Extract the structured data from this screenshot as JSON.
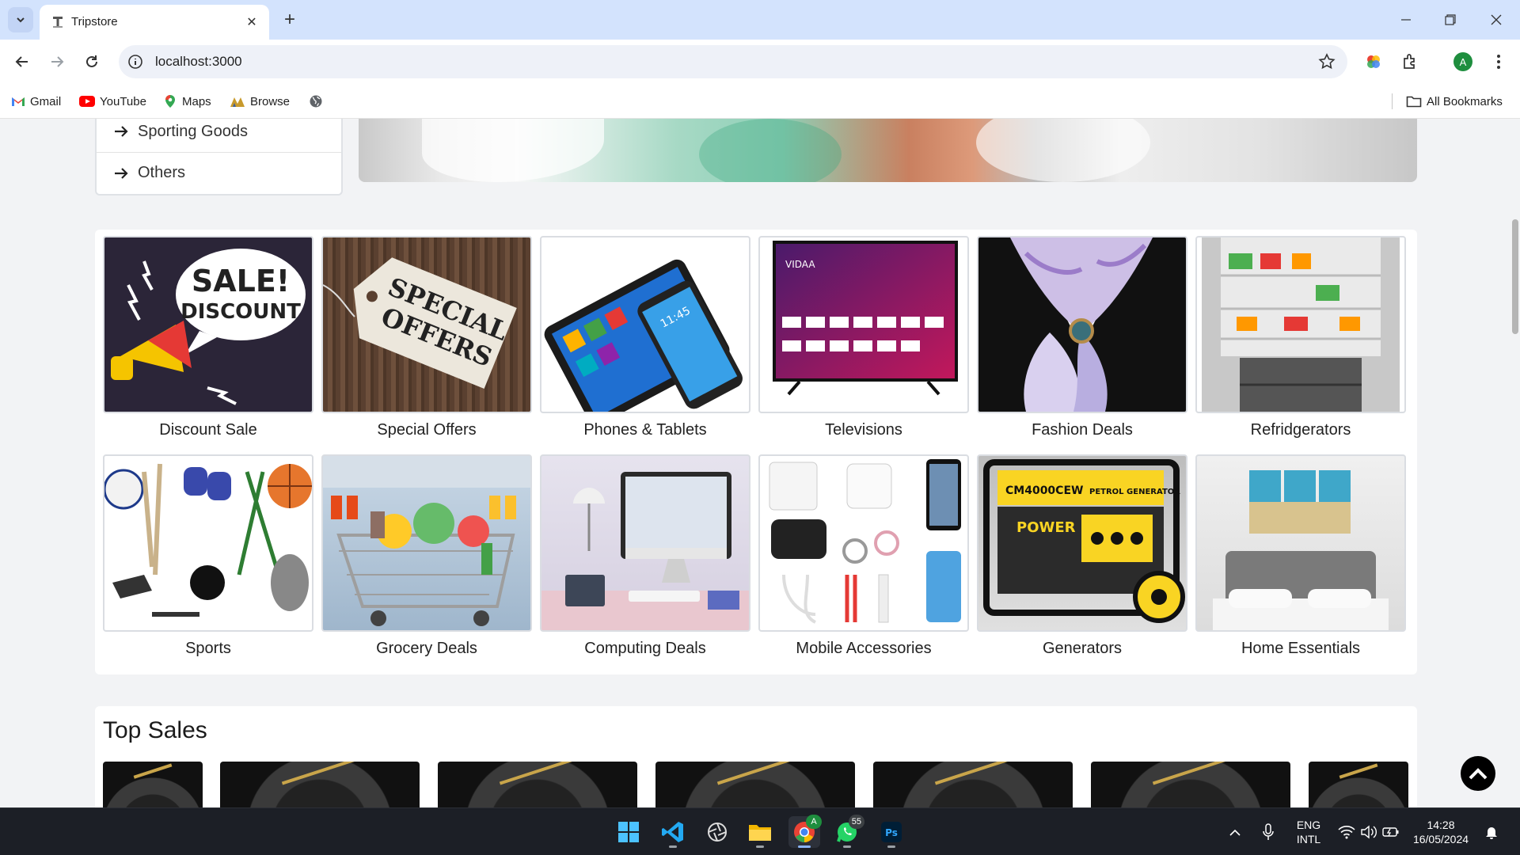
{
  "browser": {
    "tab_title": "Tripstore",
    "url": "localhost:3000",
    "profile_initial": "A",
    "bookmarks": [
      {
        "label": "Gmail",
        "icon": "gmail-icon"
      },
      {
        "label": "YouTube",
        "icon": "youtube-icon"
      },
      {
        "label": "Maps",
        "icon": "maps-icon"
      },
      {
        "label": "Browse",
        "icon": "browse-icon"
      }
    ],
    "all_bookmarks": "All Bookmarks"
  },
  "sidebar": {
    "items": [
      {
        "label": "Sporting Goods"
      },
      {
        "label": "Others"
      }
    ]
  },
  "categories": [
    {
      "label": "Discount Sale",
      "image": "sale-discount-megaphone"
    },
    {
      "label": "Special Offers",
      "image": "special-offers-tag"
    },
    {
      "label": "Phones & Tablets",
      "image": "phone-tablet"
    },
    {
      "label": "Televisions",
      "image": "smart-tv"
    },
    {
      "label": "Fashion Deals",
      "image": "silk-scarf"
    },
    {
      "label": "Refridgerators",
      "image": "open-fridge"
    },
    {
      "label": "Sports",
      "image": "sports-equipment"
    },
    {
      "label": "Grocery Deals",
      "image": "grocery-cart"
    },
    {
      "label": "Computing Deals",
      "image": "desktop-computer"
    },
    {
      "label": "Mobile Accessories",
      "image": "phone-accessories"
    },
    {
      "label": "Generators",
      "image": "petrol-generator"
    },
    {
      "label": "Home Essentials",
      "image": "bedroom"
    }
  ],
  "category_art": {
    "sale": [
      "SALE!",
      "DISCOUNT"
    ],
    "offers": [
      "SPECIAL",
      "OFFERS"
    ],
    "phone_time": "11:45",
    "tv_brand": "VIDAA",
    "generator_model": "CM4000CEW",
    "generator_title": "PETROL GENERATOR",
    "generator_brand": "POWER"
  },
  "top_sales": {
    "title": "Top Sales",
    "product_count_visible": 7
  },
  "taskbar": {
    "whatsapp_badge": "55",
    "language": "ENG",
    "layout": "INTL",
    "time": "14:28",
    "date": "16/05/2024"
  },
  "colors": {
    "tab_strip": "#d3e3fd",
    "page_bg": "#f2f3f5",
    "panel_bg": "#ffffff",
    "taskbar_bg": "#1c1f26"
  }
}
